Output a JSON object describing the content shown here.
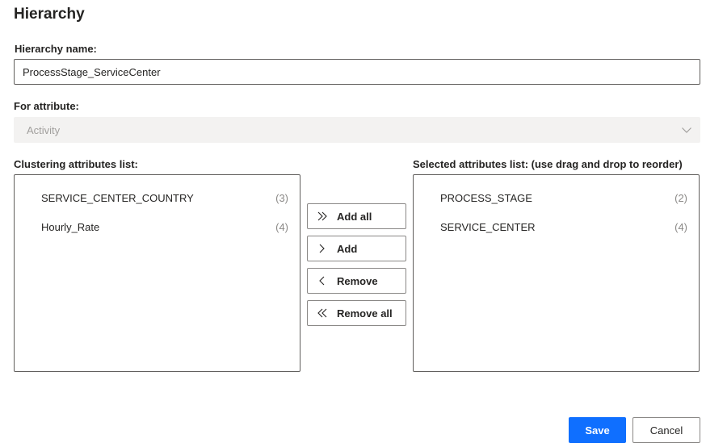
{
  "dialog": {
    "title": "Hierarchy"
  },
  "hierarchy_name": {
    "label": "Hierarchy name:",
    "value": "ProcessStage_ServiceCenter"
  },
  "for_attribute": {
    "label": "For attribute:",
    "value": "Activity",
    "disabled": true
  },
  "clustering_list": {
    "label": "Clustering attributes list:",
    "items": [
      {
        "name": "SERVICE_CENTER_COUNTRY",
        "count": "(3)"
      },
      {
        "name": "Hourly_Rate",
        "count": "(4)"
      }
    ]
  },
  "selected_list": {
    "label": "Selected attributes list: (use drag and drop to reorder)",
    "items": [
      {
        "name": "PROCESS_STAGE",
        "count": "(2)"
      },
      {
        "name": "SERVICE_CENTER",
        "count": "(4)"
      }
    ]
  },
  "transfer_buttons": {
    "add_all": "Add all",
    "add": "Add",
    "remove": "Remove",
    "remove_all": "Remove all"
  },
  "footer": {
    "save": "Save",
    "cancel": "Cancel"
  },
  "colors": {
    "primary": "#0f6fff",
    "border": "#605e5c",
    "disabled_bg": "#f3f2f1",
    "disabled_text": "#a19f9d",
    "count_text": "#8a8886"
  },
  "icons": {
    "add_all": "double-chevron-right-icon",
    "add": "chevron-right-icon",
    "remove": "chevron-left-icon",
    "remove_all": "double-chevron-left-icon",
    "dropdown": "chevron-down-icon"
  }
}
